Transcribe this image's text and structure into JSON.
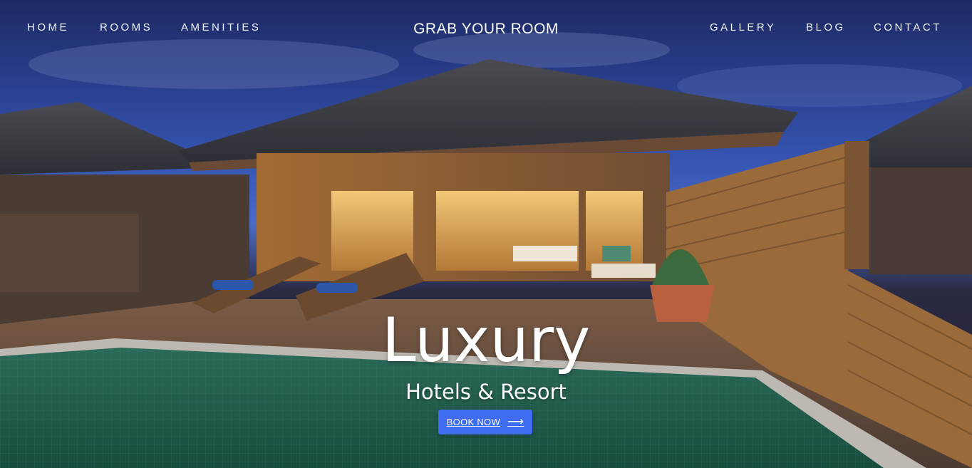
{
  "nav": {
    "left": [
      "HOME",
      "ROOMS",
      "AMENITIES"
    ],
    "brand": "GRAB YOUR ROOM",
    "right": [
      "GALLERY",
      "BLOG",
      "CONTACT"
    ]
  },
  "hero": {
    "title": "Luxury",
    "subtitle": "Hotels & Resort",
    "cta_label": "BOOK NOW",
    "cta_icon": "arrow-right-icon"
  },
  "colors": {
    "accent": "#3f6cf0",
    "sky": "#2a3f8e",
    "pool": "#1f6b57",
    "wood": "#b57a3f"
  }
}
